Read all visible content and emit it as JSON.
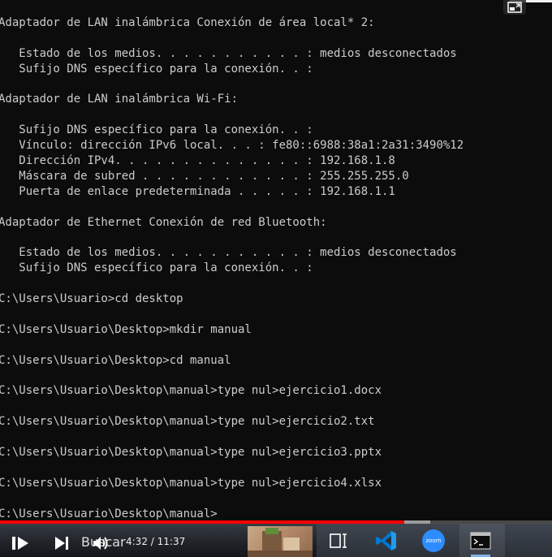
{
  "terminal": {
    "lines": [
      "Adaptador de LAN inalámbrica Conexión de área local* 2:",
      "",
      "   Estado de los medios. . . . . . . . . . . : medios desconectados",
      "   Sufijo DNS específico para la conexión. . :",
      "",
      "Adaptador de LAN inalámbrica Wi-Fi:",
      "",
      "   Sufijo DNS específico para la conexión. . :",
      "   Vínculo: dirección IPv6 local. . . : fe80::6988:38a1:2a31:3490%12",
      "   Dirección IPv4. . . . . . . . . . . . . . : 192.168.1.8",
      "   Máscara de subred . . . . . . . . . . . . : 255.255.255.0",
      "   Puerta de enlace predeterminada . . . . . : 192.168.1.1",
      "",
      "Adaptador de Ethernet Conexión de red Bluetooth:",
      "",
      "   Estado de los medios. . . . . . . . . . . : medios desconectados",
      "   Sufijo DNS específico para la conexión. . :",
      "",
      "C:\\Users\\Usuario>cd desktop",
      "",
      "C:\\Users\\Usuario\\Desktop>mkdir manual",
      "",
      "C:\\Users\\Usuario\\Desktop>cd manual",
      "",
      "C:\\Users\\Usuario\\Desktop\\manual>type nul>ejercicio1.docx",
      "",
      "C:\\Users\\Usuario\\Desktop\\manual>type nul>ejercicio2.txt",
      "",
      "C:\\Users\\Usuario\\Desktop\\manual>type nul>ejercicio3.pptx",
      "",
      "C:\\Users\\Usuario\\Desktop\\manual>type nul>ejercicio4.xlsx",
      "",
      "C:\\Users\\Usuario\\Desktop\\manual>"
    ]
  },
  "video": {
    "current_time": "4:32",
    "separator": " / ",
    "duration": "11:37",
    "progress_fraction": 0.733,
    "buffered_fraction": 0.78,
    "played_color": "#ff0000"
  },
  "taskbar": {
    "search_label": "Buscar",
    "zoom_label": "zoom",
    "icons": [
      "task-view-icon",
      "vscode-icon",
      "zoom-icon",
      "terminal-icon"
    ],
    "accent": "#2d8cff"
  },
  "icons": {
    "pip": "picture-in-picture-icon",
    "play": "play-icon",
    "next": "next-icon",
    "volume": "volume-icon"
  }
}
